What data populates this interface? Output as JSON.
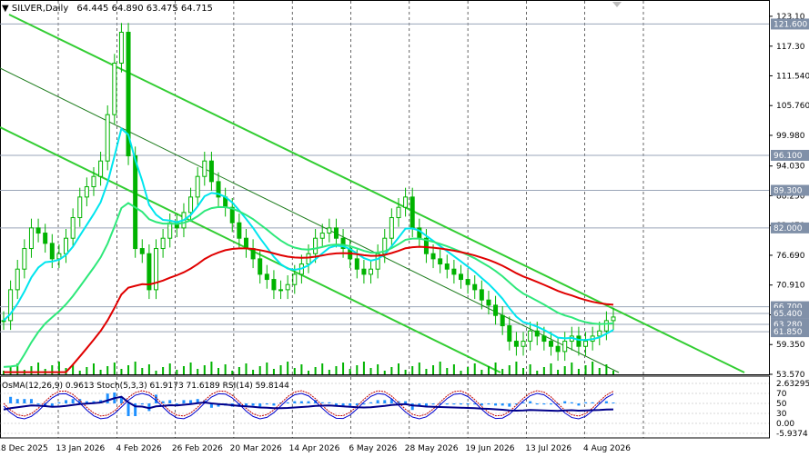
{
  "header": {
    "symbol": "SILVER,Daily",
    "ohlc": "64.445 64.890 63.475 64.715"
  },
  "indicator_header": {
    "text": "OsMA(12,26,9) 0.9613 Stoch(5,3,3) 61.9173 71.6189 RSI(14) 59.8144"
  },
  "colors": {
    "channel": "#32cd32",
    "ema_fast": "#00e5ee",
    "ema_mid": "#2ee87a",
    "ema_slow": "#e00000",
    "level_lines": "#9aa5b8",
    "candles": "#00b300",
    "volume": "#00b300",
    "osma": "#1e90ff",
    "rsi": "#00008b",
    "stoch_main": "#c00000",
    "stoch_signal": "#0000cd"
  },
  "chart_data": {
    "type": "candlestick",
    "title": "SILVER,Daily",
    "x_labels": [
      "18 Dec 2025",
      "13 Jan 2026",
      "4 Feb 2026",
      "26 Feb 2026",
      "20 Mar 2026",
      "14 Apr 2026",
      "6 May 2026",
      "28 May 2026",
      "19 Jun 2026",
      "13 Jul 2026",
      "4 Aug 2026"
    ],
    "y_ticks": [
      "123.10",
      "117.30",
      "111.540",
      "105.760",
      "99.980",
      "94.030",
      "88.250",
      "82.470",
      "76.690",
      "70.910",
      "65.130",
      "59.350",
      "53.570"
    ],
    "price_levels": [
      {
        "label": "121.600",
        "value": 121.6
      },
      {
        "label": "96.100",
        "value": 96.1
      },
      {
        "label": "89.300",
        "value": 89.3
      },
      {
        "label": "82.000",
        "value": 82.0
      },
      {
        "label": "66.700",
        "value": 66.7
      },
      {
        "label": "65.400",
        "value": 65.4
      },
      {
        "label": "63.280",
        "value": 63.28
      },
      {
        "label": "61.850",
        "value": 61.85
      }
    ],
    "indicator_levels": [
      "2.63295",
      "70",
      "50",
      "30",
      "0.00",
      "-5.9374"
    ],
    "closes": [
      64,
      70,
      74,
      78,
      82,
      81,
      79,
      76,
      77,
      80,
      84,
      88,
      90,
      92,
      95,
      104,
      114,
      120,
      96,
      78,
      77,
      70,
      78,
      80,
      83,
      82,
      85,
      88,
      92,
      95,
      91,
      88,
      86,
      83,
      80,
      78,
      76,
      73,
      72,
      70,
      70,
      71,
      73,
      75,
      77,
      80,
      81,
      82,
      80,
      78,
      76,
      74,
      73,
      74,
      77,
      80,
      84,
      86,
      88,
      82,
      80,
      77,
      76,
      75,
      74,
      73,
      72,
      71,
      70,
      68,
      67,
      65,
      63,
      60,
      59,
      60,
      62,
      61,
      60,
      59,
      58,
      60,
      61,
      59,
      60,
      61,
      62,
      64,
      64.7
    ]
  }
}
